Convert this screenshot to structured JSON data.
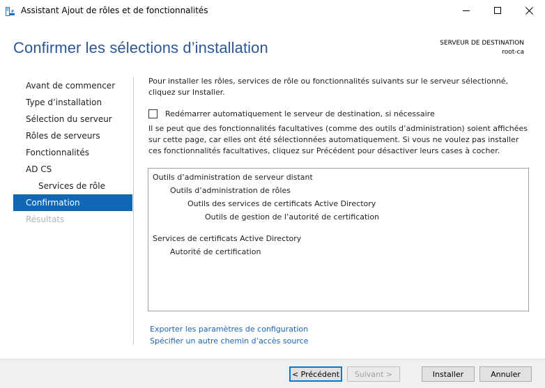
{
  "window": {
    "title": "Assistant Ajout de rôles et de fonctionnalités",
    "icon": "server-manager-icon"
  },
  "header": {
    "title": "Confirmer les sélections d’installation",
    "destination_label": "SERVEUR DE DESTINATION",
    "destination_server": "root-ca"
  },
  "nav": {
    "items": [
      {
        "label": "Avant de commencer",
        "state": "normal"
      },
      {
        "label": "Type d’installation",
        "state": "normal"
      },
      {
        "label": "Sélection du serveur",
        "state": "normal"
      },
      {
        "label": "Rôles de serveurs",
        "state": "normal"
      },
      {
        "label": "Fonctionnalités",
        "state": "normal"
      },
      {
        "label": "AD CS",
        "state": "normal"
      },
      {
        "label": "Services de rôle",
        "state": "sub"
      },
      {
        "label": "Confirmation",
        "state": "active"
      },
      {
        "label": "Résultats",
        "state": "disabled"
      }
    ]
  },
  "main": {
    "intro": "Pour installer les rôles, services de rôle ou fonctionnalités suivants sur le serveur sélectionné, cliquez sur Installer.",
    "restart_checkbox_label": "Redémarrer automatiquement le serveur de destination, si nécessaire",
    "restart_checked": false,
    "info": "Il se peut que des fonctionnalités facultatives (comme des outils d’administration) soient affichées sur cette page, car elles ont été sélectionnées automatiquement. Si vous ne voulez pas installer ces fonctionnalités facultatives, cliquez sur Précédent pour désactiver leurs cases à cocher.",
    "selections": [
      {
        "label": "Outils d’administration de serveur distant",
        "level": 0
      },
      {
        "label": "Outils d’administration de rôles",
        "level": 1
      },
      {
        "label": "Outils des services de certificats Active Directory",
        "level": 2
      },
      {
        "label": "Outils de gestion de l’autorité de certification",
        "level": 3
      },
      {
        "label": "Services de certificats Active Directory",
        "level": 0
      },
      {
        "label": "Autorité de certification",
        "level": 1
      }
    ],
    "links": {
      "export": "Exporter les paramètres de configuration",
      "alt_source": "Spécifier un autre chemin d’accès source"
    }
  },
  "footer": {
    "previous": "< Précédent",
    "next": "Suivant >",
    "install": "Installer",
    "cancel": "Annuler"
  },
  "colors": {
    "heading": "#2b5797",
    "nav_active_bg": "#0f67b6",
    "link": "#1a65b4"
  }
}
